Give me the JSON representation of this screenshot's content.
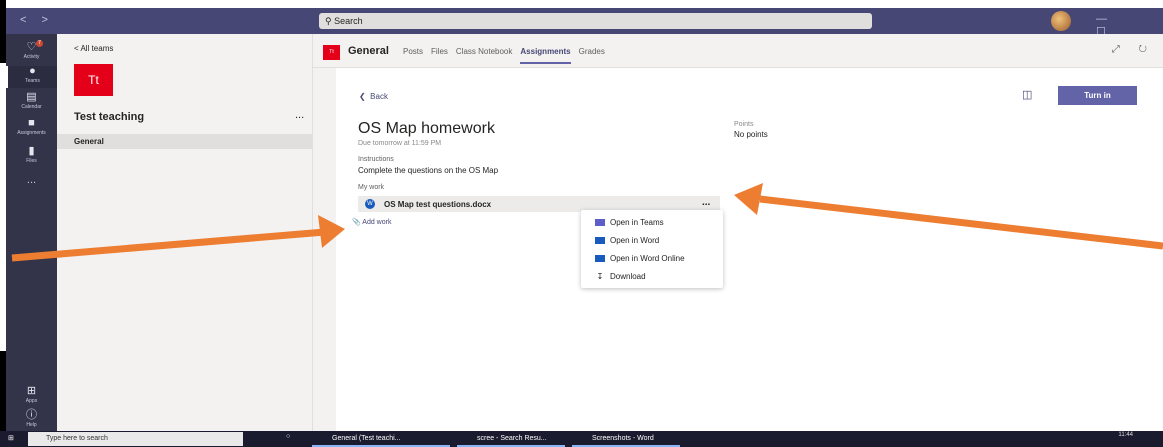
{
  "window": {
    "search_placeholder": "Search",
    "nav_arrows": "< >",
    "window_controls": "— ☐ ✕"
  },
  "app_bar": {
    "items": [
      {
        "label": "Activity",
        "icon": "bell-icon",
        "badge": "7"
      },
      {
        "label": "Teams",
        "icon": "teams-icon"
      },
      {
        "label": "Calendar",
        "icon": "calendar-icon"
      },
      {
        "label": "Assignments",
        "icon": "assignments-icon"
      },
      {
        "label": "Files",
        "icon": "file-icon"
      },
      {
        "label": "...",
        "icon": "more-icon"
      }
    ],
    "apps_label": "Apps",
    "help_label": "Help"
  },
  "team_pane": {
    "back_label": "< All teams",
    "team_initials": "Tt",
    "team_name": "Test teaching",
    "more": "...",
    "channels": [
      "General"
    ]
  },
  "header": {
    "channel_initials": "Tt",
    "channel_name": "General",
    "tabs": [
      "Posts",
      "Files",
      "Class Notebook",
      "Assignments",
      "Grades"
    ],
    "active_tab": "Assignments"
  },
  "assignment": {
    "back_label": "Back",
    "turn_in_label": "Turn in",
    "title": "OS Map homework",
    "due": "Due tomorrow at 11:59 PM",
    "points_label": "Points",
    "points_value": "No points",
    "instructions_label": "Instructions",
    "instructions_text": "Complete the questions on the OS Map",
    "my_work_label": "My work",
    "file_name": "OS Map test questions.docx",
    "file_more": "...",
    "add_work_label": "Add work"
  },
  "file_menu": {
    "items": [
      {
        "label": "Open in Teams",
        "icon": "teams-icon",
        "color": "#5b5fc7"
      },
      {
        "label": "Open in Word",
        "icon": "word-icon",
        "color": "#185abd"
      },
      {
        "label": "Open in Word Online",
        "icon": "word-icon",
        "color": "#185abd"
      },
      {
        "label": "Download",
        "icon": "download-icon",
        "color": "#605e5c"
      }
    ]
  },
  "taskbar": {
    "search_placeholder": "Type here to search",
    "tasks": [
      "General (Test teachi...",
      "scree - Search Resu...",
      "Screenshots - Word"
    ],
    "time": "11:44"
  },
  "colors": {
    "accent": "#6264a7",
    "titlebar": "#464775",
    "appbar": "#33344a",
    "team_red": "#e5001a",
    "arrow": "#ed7d31"
  }
}
